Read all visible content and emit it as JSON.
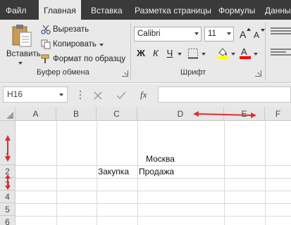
{
  "ribbon_tabs": [
    "Файл",
    "Главная",
    "Вставка",
    "Разметка страницы",
    "Формулы",
    "Данны"
  ],
  "clipboard": {
    "paste_label": "Вставить",
    "cut_label": "Вырезать",
    "copy_label": "Копировать",
    "format_painter_label": "Формат по образцу",
    "group_label": "Буфер обмена"
  },
  "font": {
    "family": "Calibri",
    "size": "11",
    "bold": "Ж",
    "italic": "К",
    "underline": "Ч",
    "group_label": "Шрифт",
    "highlight_color": "#ffff00",
    "font_color": "#ff0000"
  },
  "formula_bar": {
    "name_box": "H16",
    "fx_label": "fx",
    "formula": ""
  },
  "sheet": {
    "columns": [
      "A",
      "B",
      "C",
      "D",
      "E",
      "F"
    ],
    "rows": [
      "1",
      "2",
      "3",
      "4",
      "5",
      "6"
    ],
    "cells": {
      "D1": "Москва",
      "C2": "Закупка",
      "D2": "Продажа"
    }
  },
  "colors": {
    "tab_bar": "#3a3a3a",
    "ribbon": "#e9e9e9",
    "annotation_arrows": "#d9302c"
  }
}
